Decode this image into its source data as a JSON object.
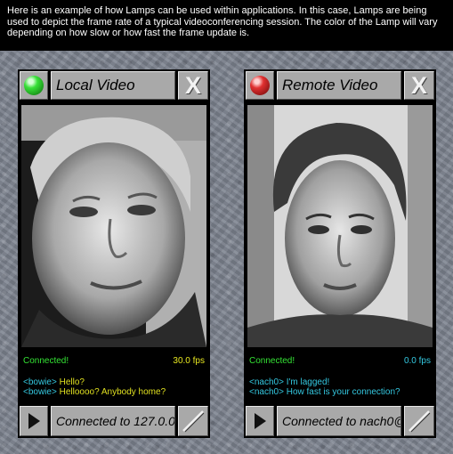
{
  "intro": {
    "text": "Here is an example of how Lamps can be used within applications. In this case, Lamps are being used to depict the frame rate of a typical videoconferencing session. The color of the Lamp will vary depending on how slow or how fast the frame update is."
  },
  "panels": [
    {
      "title": "Local Video",
      "lamp_color": "green",
      "close_label": "X",
      "status": "Connected!",
      "fps": "30.0 fps",
      "chat": [
        {
          "nick": "<bowie>",
          "message": "Hello?"
        },
        {
          "nick": "<bowie>",
          "message": "Helloooo? Anybody home?"
        }
      ],
      "connection": "Connected to 127.0.0"
    },
    {
      "title": "Remote Video",
      "lamp_color": "red",
      "close_label": "X",
      "status": "Connected!",
      "fps": "0.0 fps",
      "chat": [
        {
          "nick": "<nach0>",
          "message": "I'm lagged!"
        },
        {
          "nick": "<nach0>",
          "message": "How fast is your connection?"
        }
      ],
      "connection": "Connected to nach0@"
    }
  ],
  "icons": {
    "lamp": "lamp-icon",
    "close": "close-icon",
    "play": "play-icon",
    "resize": "resize-icon"
  },
  "colors": {
    "status_green": "#34e334",
    "fps_yellow": "#e8e820",
    "chat_cyan": "#34c8e0",
    "lamp_green": "#38e038",
    "lamp_red": "#e03030"
  }
}
